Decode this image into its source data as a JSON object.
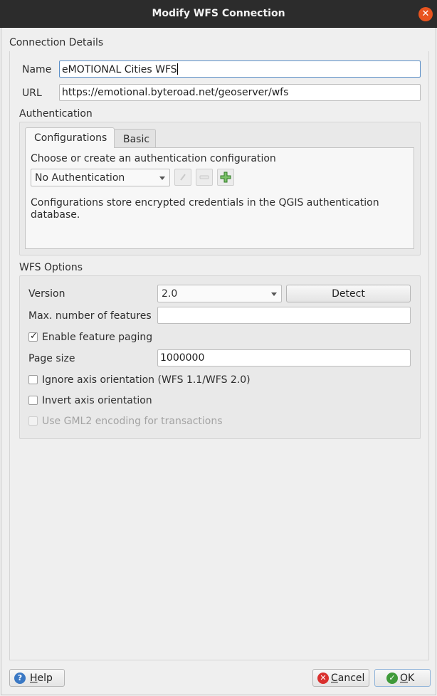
{
  "window": {
    "title": "Modify WFS Connection",
    "close_glyph": "✕"
  },
  "connection_details": {
    "section_title": "Connection Details",
    "name_label": "Name",
    "name_value": "eMOTIONAL Cities WFS",
    "url_label": "URL",
    "url_value": "https://emotional.byteroad.net/geoserver/wfs"
  },
  "authentication": {
    "section_title": "Authentication",
    "tabs": [
      {
        "label": "Configurations",
        "active": true
      },
      {
        "label": "Basic",
        "active": false
      }
    ],
    "choose_label": "Choose or create an authentication configuration",
    "config_selected": "No Authentication",
    "description": "Configurations store encrypted credentials in the QGIS authentication database.",
    "description_line1": "Configurations store encrypted credentials in the QGIS authentication",
    "description_line2": "database."
  },
  "wfs_options": {
    "section_title": "WFS Options",
    "version_label": "Version",
    "version_value": "2.0",
    "detect_label": "Detect",
    "max_features_label": "Max. number of features",
    "max_features_value": "",
    "enable_paging_label": "Enable feature paging",
    "enable_paging_checked": true,
    "page_size_label": "Page size",
    "page_size_value": "1000000",
    "ignore_axis_label": "Ignore axis orientation (WFS 1.1/WFS 2.0)",
    "ignore_axis_checked": false,
    "invert_axis_label": "Invert axis orientation",
    "invert_axis_checked": false,
    "gml2_label": "Use GML2 encoding for transactions",
    "gml2_checked": false,
    "gml2_enabled": false
  },
  "buttons": {
    "help_label": "Help",
    "cancel_label": "Cancel",
    "ok_label": "OK",
    "help_glyph": "?",
    "cancel_glyph": "✕",
    "ok_glyph": "✓"
  },
  "colors": {
    "titlebar": "#2c2c2c",
    "close_button": "#e9541f",
    "help_icon": "#3a78c4",
    "cancel_icon": "#d9302e",
    "ok_icon": "#3f9a3a",
    "focus_border": "#5b8fc7"
  }
}
